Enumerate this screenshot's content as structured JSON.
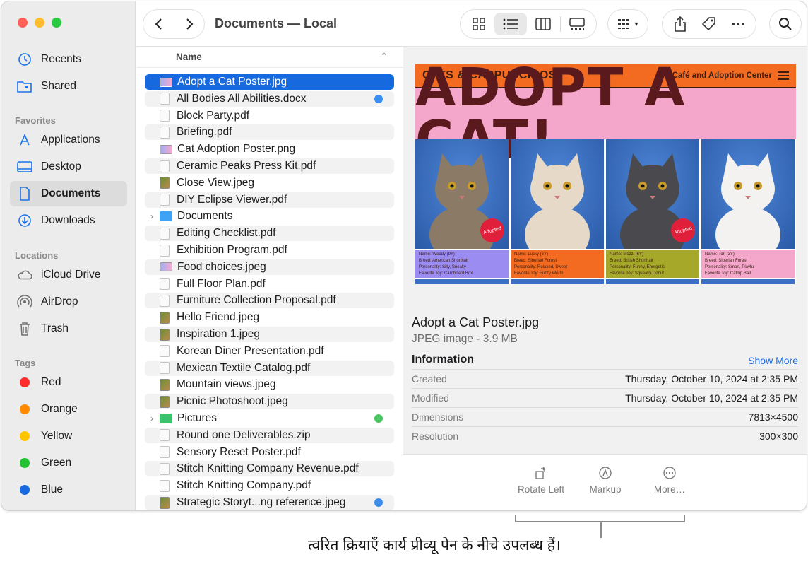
{
  "window": {
    "title": "Documents — Local"
  },
  "sidebar": {
    "items_top": [
      {
        "label": "Recents",
        "icon": "clock-icon"
      },
      {
        "label": "Shared",
        "icon": "shared-folder-icon"
      }
    ],
    "favorites_heading": "Favorites",
    "favorites": [
      {
        "label": "Applications",
        "icon": "applications-icon"
      },
      {
        "label": "Desktop",
        "icon": "desktop-icon"
      },
      {
        "label": "Documents",
        "icon": "document-icon"
      },
      {
        "label": "Downloads",
        "icon": "download-icon"
      }
    ],
    "locations_heading": "Locations",
    "locations": [
      {
        "label": "iCloud Drive",
        "icon": "cloud-icon"
      },
      {
        "label": "AirDrop",
        "icon": "airdrop-icon"
      },
      {
        "label": "Trash",
        "icon": "trash-icon"
      }
    ],
    "tags_heading": "Tags",
    "tags": [
      {
        "label": "Red",
        "color": "#ff2d2d"
      },
      {
        "label": "Orange",
        "color": "#ff8a00"
      },
      {
        "label": "Yellow",
        "color": "#ffc400"
      },
      {
        "label": "Green",
        "color": "#24c132"
      },
      {
        "label": "Blue",
        "color": "#1769e0"
      }
    ]
  },
  "list": {
    "column_name": "Name",
    "files": [
      {
        "name": "Adopt a Cat Poster.jpg",
        "kind": "png",
        "selected": true
      },
      {
        "name": "All Bodies All Abilities.docx",
        "kind": "doc",
        "tag": "#3b8ff0"
      },
      {
        "name": "Block Party.pdf",
        "kind": "doc"
      },
      {
        "name": "Briefing.pdf",
        "kind": "doc"
      },
      {
        "name": "Cat Adoption Poster.png",
        "kind": "png"
      },
      {
        "name": "Ceramic Peaks Press Kit.pdf",
        "kind": "doc"
      },
      {
        "name": "Close View.jpeg",
        "kind": "img"
      },
      {
        "name": "DIY Eclipse Viewer.pdf",
        "kind": "doc"
      },
      {
        "name": "Documents",
        "kind": "folder"
      },
      {
        "name": "Editing Checklist.pdf",
        "kind": "doc"
      },
      {
        "name": "Exhibition Program.pdf",
        "kind": "doc"
      },
      {
        "name": "Food choices.jpeg",
        "kind": "png"
      },
      {
        "name": "Full Floor Plan.pdf",
        "kind": "doc"
      },
      {
        "name": "Furniture Collection Proposal.pdf",
        "kind": "doc"
      },
      {
        "name": "Hello Friend.jpeg",
        "kind": "img"
      },
      {
        "name": "Inspiration 1.jpeg",
        "kind": "img"
      },
      {
        "name": "Korean Diner Presentation.pdf",
        "kind": "doc"
      },
      {
        "name": "Mexican Textile Catalog.pdf",
        "kind": "doc"
      },
      {
        "name": "Mountain views.jpeg",
        "kind": "img"
      },
      {
        "name": "Picnic Photoshoot.jpeg",
        "kind": "img"
      },
      {
        "name": "Pictures",
        "kind": "folder-green",
        "tag": "#4cc764"
      },
      {
        "name": "Round one Deliverables.zip",
        "kind": "doc"
      },
      {
        "name": "Sensory Reset Poster.pdf",
        "kind": "doc"
      },
      {
        "name": "Stitch Knitting Company Revenue.pdf",
        "kind": "doc"
      },
      {
        "name": "Stitch Knitting Company.pdf",
        "kind": "doc"
      },
      {
        "name": "Strategic Storyt...ng reference.jpeg",
        "kind": "img",
        "tag": "#3b8ff0"
      }
    ]
  },
  "poster": {
    "brand": "CATS & CAPPUCCINOS",
    "cafe": "Café and Adoption Center",
    "headline": "ADOPT A CAT!",
    "badge": "Adopted",
    "cats": [
      {
        "l1": "Name: Woody (9Y)",
        "l2": "Breed: American Shorthair",
        "l3": "Personality: Silly, Sneaky",
        "l4": "Favorite Toy: Cardboard Box",
        "color": "#9b8cf2",
        "adopted": true
      },
      {
        "l1": "Name: Lucky (6Y)",
        "l2": "Breed: Siberian Forest",
        "l3": "Personality: Relaxed, Sweet",
        "l4": "Favorite Toy: Fuzzy Worm",
        "color": "#f26b21",
        "adopted": false
      },
      {
        "l1": "Name: Mozzi (6Y)",
        "l2": "Breed: British Shorthair",
        "l3": "Personality: Funny, Energetic",
        "l4": "Favorite Toy: Squeaky Donut",
        "color": "#a6a82a",
        "adopted": true
      },
      {
        "l1": "Name: Tori (3Y)",
        "l2": "Breed: Siberian Forest",
        "l3": "Personality: Smart, Playful",
        "l4": "Favorite Toy: Catnip Ball",
        "color": "#f4a7cb",
        "adopted": false
      }
    ]
  },
  "preview": {
    "file_name": "Adopt a Cat Poster.jpg",
    "kind": "JPEG image - 3.9 MB",
    "info_heading": "Information",
    "show_more": "Show More",
    "rows": [
      {
        "k": "Created",
        "v": "Thursday, October 10, 2024 at 2:35 PM"
      },
      {
        "k": "Modified",
        "v": "Thursday, October 10, 2024 at 2:35 PM"
      },
      {
        "k": "Dimensions",
        "v": "7813×4500"
      },
      {
        "k": "Resolution",
        "v": "300×300"
      }
    ],
    "quick_actions": [
      {
        "label": "Rotate Left",
        "icon": "rotate-left-icon"
      },
      {
        "label": "Markup",
        "icon": "markup-icon"
      },
      {
        "label": "More…",
        "icon": "more-icon"
      }
    ]
  },
  "callout": {
    "text": "त्वरित क्रियाएँ कार्य प्रीव्यू पेन के नीचे उपलब्ध हैं।"
  }
}
